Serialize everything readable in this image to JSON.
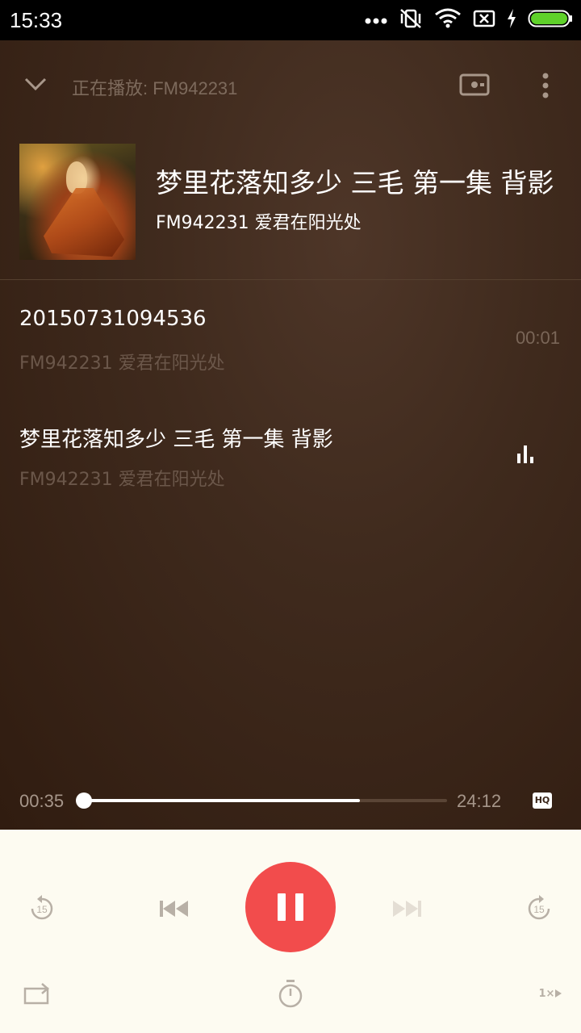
{
  "status_bar": {
    "time": "15:33",
    "icons": [
      "more-dots-icon",
      "vibrate-off-icon",
      "wifi-icon",
      "sim-off-icon",
      "charging-icon",
      "battery-icon"
    ],
    "battery_color": "#5fd12a"
  },
  "header": {
    "now_playing": "正在播放: FM942231",
    "icons": [
      "collapse-chevron-icon",
      "radio-icon",
      "more-vertical-icon"
    ]
  },
  "track": {
    "title": "梦里花落知多少 三毛 第一集 背影",
    "subtitle": "FM942231 爱君在阳光处"
  },
  "playlist": [
    {
      "title": "20150731094536",
      "subtitle": "FM942231 爱君在阳光处",
      "duration": "00:01",
      "playing": false
    },
    {
      "title": "梦里花落知多少 三毛 第一集 背影",
      "subtitle": "FM942231 爱君在阳光处",
      "duration": "",
      "playing": true
    }
  ],
  "progress": {
    "current": "00:35",
    "total": "24:12",
    "fraction": 0.76,
    "quality_badge": "HQ"
  },
  "controls": {
    "accent_color": "#f24c4c",
    "rewind_label": "15",
    "forward_label": "15",
    "speed_label": "1×",
    "icons": [
      "rewind-15-icon",
      "previous-icon",
      "pause-icon",
      "next-icon",
      "forward-15-icon",
      "repeat-icon",
      "timer-icon",
      "speed-icon"
    ]
  }
}
